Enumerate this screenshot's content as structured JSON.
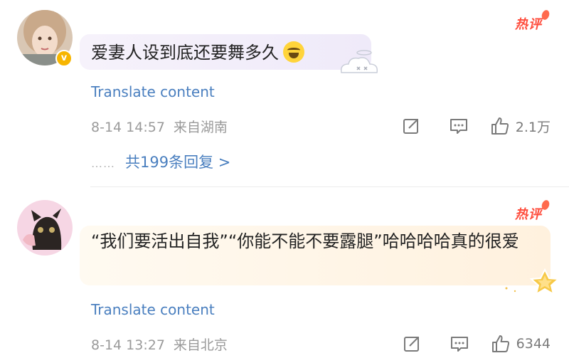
{
  "comments": [
    {
      "hot_label": "热评",
      "text": "爱妻人设到底还要舞多久",
      "emoji": "laughing-tears-emoji",
      "translate_label": "Translate content",
      "date": "8-14 14:57",
      "location": "来自湖南",
      "likes": "2.1万",
      "replies_label": "共199条回复 >",
      "verified": true
    },
    {
      "hot_label": "热评",
      "text": "“我们要活出自我”“你能不能不要露腿”哈哈哈哈真的很爱",
      "translate_label": "Translate content",
      "date": "8-14 13:27",
      "location": "来自北京",
      "likes": "6344"
    }
  ],
  "colors": {
    "hot": "#ff4d3d",
    "link": "#4a7fbf",
    "meta": "#9a9a9a",
    "bubble1": "#f1ecf9",
    "bubble2": "#fff3e2"
  },
  "icons": [
    "share-icon",
    "comment-icon",
    "like-icon",
    "verified-badge-icon",
    "angel-sticker-icon",
    "star-badge-sticker-icon"
  ]
}
